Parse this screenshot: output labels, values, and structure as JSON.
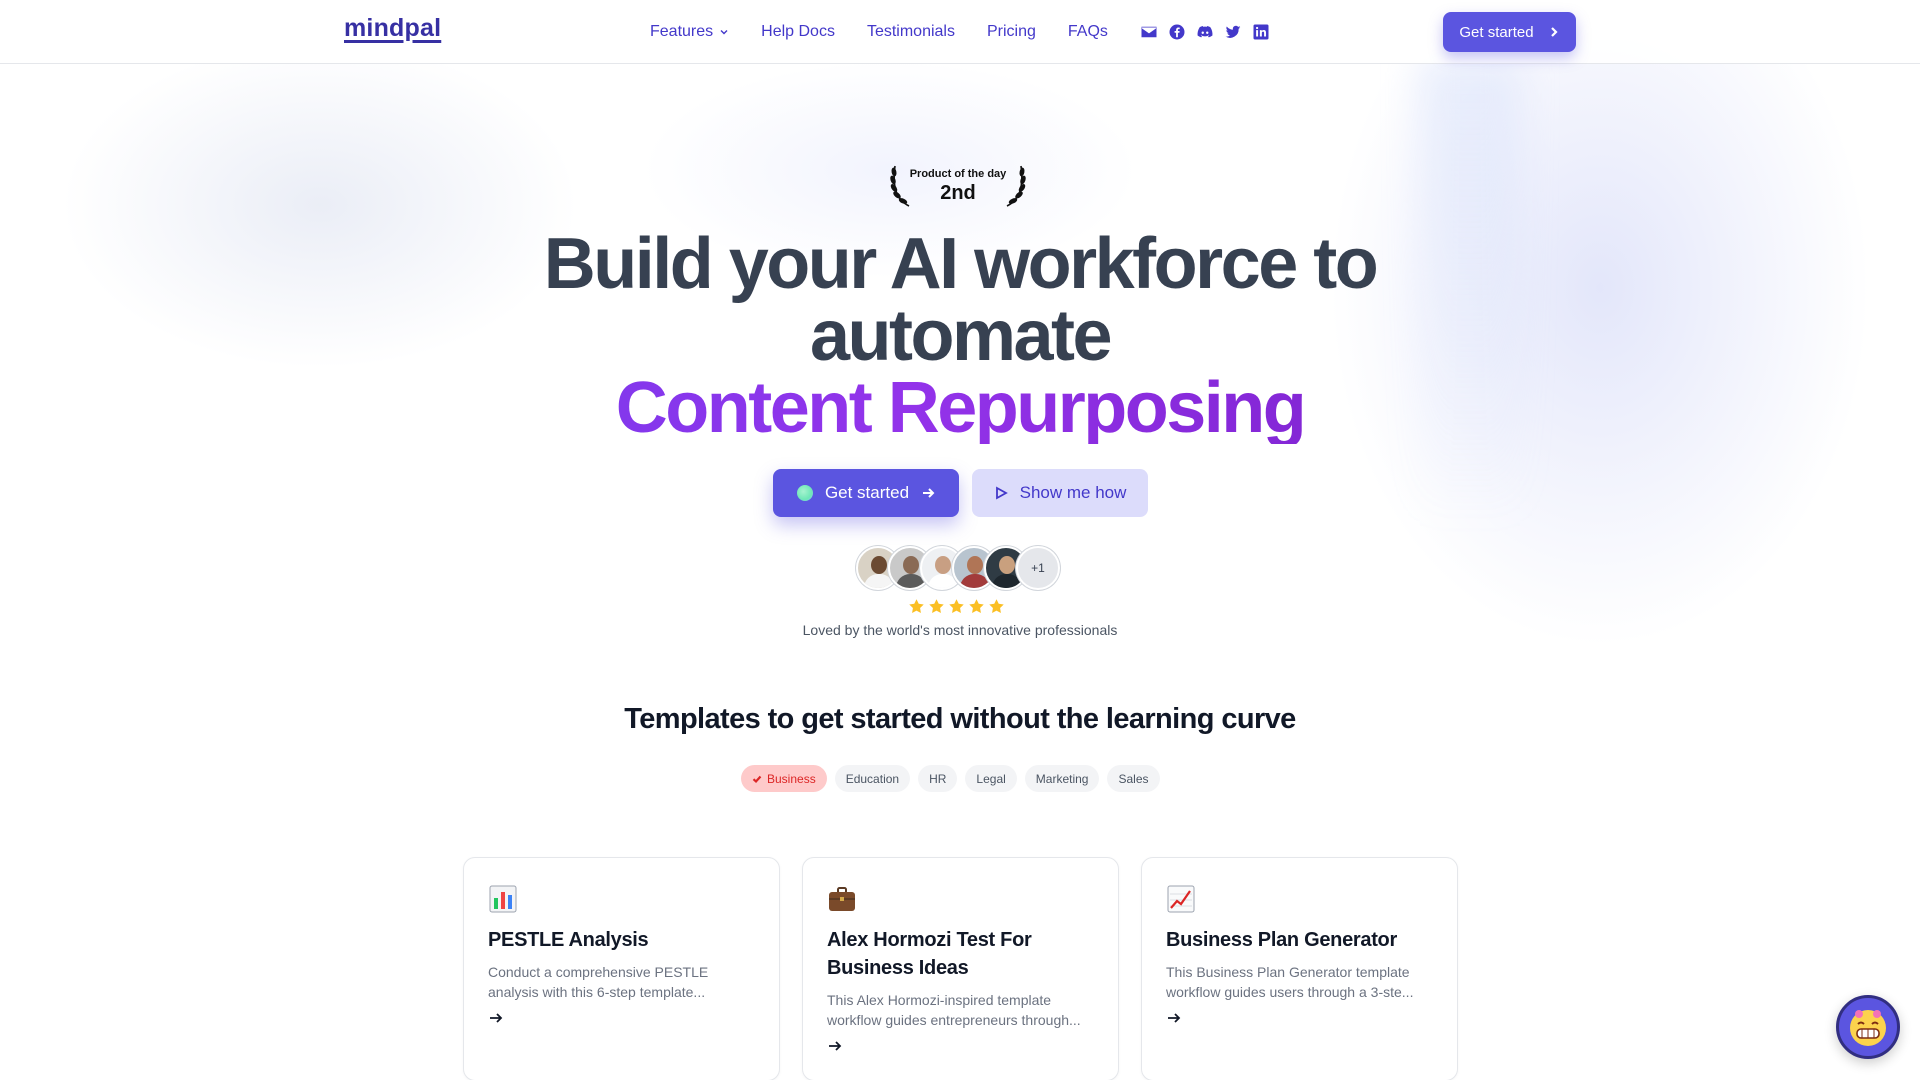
{
  "nav": {
    "logo": "mindpal",
    "links": [
      {
        "label": "Features",
        "dropdown": true
      },
      {
        "label": "Help Docs"
      },
      {
        "label": "Testimonials"
      },
      {
        "label": "Pricing"
      },
      {
        "label": "FAQs"
      }
    ],
    "social_icons": [
      "mail-icon",
      "facebook-icon",
      "discord-icon",
      "twitter-icon",
      "linkedin-icon"
    ],
    "cta": "Get started"
  },
  "award": {
    "line1": "Product of the day",
    "line2": "2nd"
  },
  "hero": {
    "line1": "Build your AI workforce to",
    "line2": "automate",
    "accent": "Content Repurposing",
    "primary_cta": "Get started",
    "secondary_cta": "Show me how",
    "avatar_more": "+1",
    "rating": 5,
    "tagline": "Loved by the world's most innovative professionals"
  },
  "templates": {
    "title_regular": "Templates to get started",
    "title_bold": "without the learning curve",
    "categories": [
      {
        "label": "Business",
        "active": true
      },
      {
        "label": "Education",
        "active": false
      },
      {
        "label": "HR",
        "active": false
      },
      {
        "label": "Legal",
        "active": false
      },
      {
        "label": "Marketing",
        "active": false
      },
      {
        "label": "Sales",
        "active": false
      }
    ],
    "cards": [
      {
        "icon": "bar-chart-icon",
        "title": "PESTLE Analysis",
        "desc": "Conduct a comprehensive PESTLE analysis with this 6-step template..."
      },
      {
        "icon": "briefcase-icon",
        "title": "Alex Hormozi Test For Business Ideas",
        "desc": "This Alex Hormozi-inspired template workflow guides entrepreneurs through..."
      },
      {
        "icon": "trend-chart-icon",
        "title": "Business Plan Generator",
        "desc": "This Business Plan Generator template workflow guides users through a 3-ste..."
      }
    ]
  },
  "colors": {
    "brand": "#5b55e0",
    "accent_purple": "#7c3aed",
    "chip_active_bg": "#fecaca",
    "chip_active_text": "#dc2626"
  }
}
